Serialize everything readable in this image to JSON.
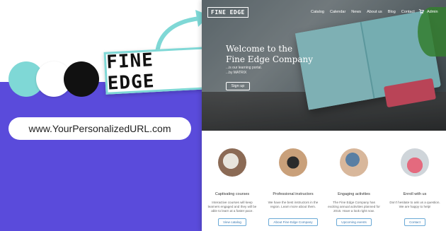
{
  "brand": {
    "name": "FINE EDGE",
    "url": "www.YourPersonalizedURL.com",
    "colors": {
      "teal": "#7fd8d6",
      "white": "#ffffff",
      "black": "#111111",
      "purple": "#5a4bdb"
    }
  },
  "site": {
    "logo": "FINE EDGE",
    "nav": [
      "Catalog",
      "Calendar",
      "News",
      "About us",
      "Blog",
      "Contact"
    ],
    "admin_label": "Admin",
    "hero": {
      "title_line1": "Welcome to the",
      "title_line2": "Fine Edge Company",
      "sub_line1": "...is our learning portal.",
      "sub_line2": "...by MATRIX",
      "button": "Sign up"
    },
    "features": [
      {
        "title": "Captivating courses",
        "text": "Interactive courses will keep learners engaged and they will be able to learn at a faster pace.",
        "button": "View catalog"
      },
      {
        "title": "Professional instructors",
        "text": "We have the best instructors in the region. Learn more about them.",
        "button": "About Fine Edge Company"
      },
      {
        "title": "Engaging activities",
        "text": "The Fine Edge Company has exciting annual activities planned for 2015. Have a look right now.",
        "button": "Upcoming events"
      },
      {
        "title": "Enroll with us",
        "text": "Don't hesitate to ask us a question. We are happy to help!",
        "button": "Contact"
      }
    ]
  }
}
